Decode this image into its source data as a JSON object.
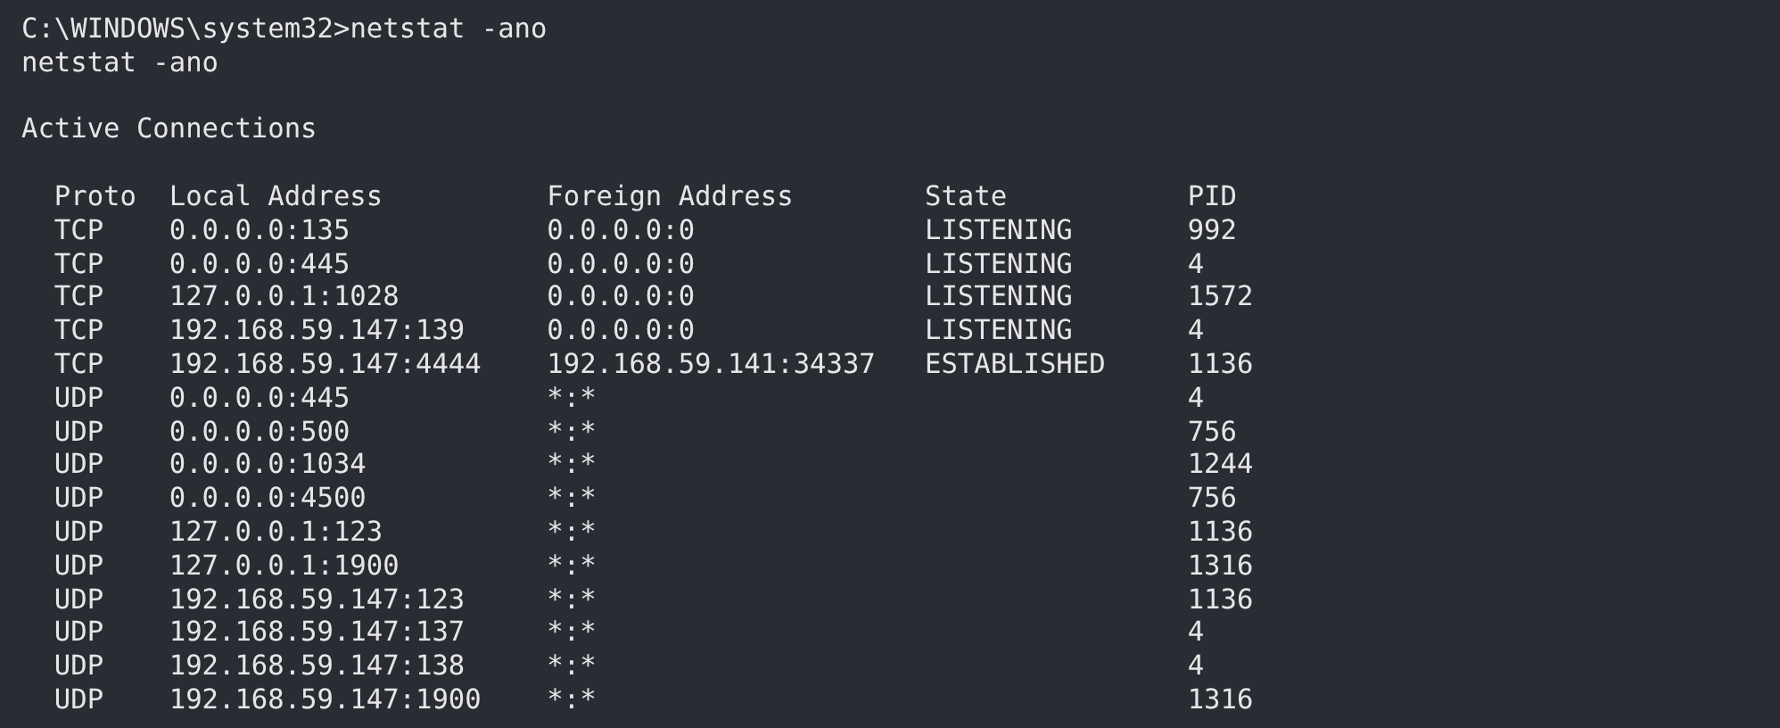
{
  "terminal": {
    "lines": [
      {
        "kind": "text",
        "text": "C:\\WINDOWS\\system32>netstat -ano"
      },
      {
        "kind": "text",
        "text": "netstat -ano"
      },
      {
        "kind": "blank"
      },
      {
        "kind": "text",
        "text": "Active Connections"
      },
      {
        "kind": "blank"
      }
    ],
    "table": {
      "columns": [
        "Proto",
        "Local Address",
        "Foreign Address",
        "State",
        "PID"
      ],
      "rows": [
        [
          "TCP",
          "0.0.0.0:135",
          "0.0.0.0:0",
          "LISTENING",
          "992"
        ],
        [
          "TCP",
          "0.0.0.0:445",
          "0.0.0.0:0",
          "LISTENING",
          "4"
        ],
        [
          "TCP",
          "127.0.0.1:1028",
          "0.0.0.0:0",
          "LISTENING",
          "1572"
        ],
        [
          "TCP",
          "192.168.59.147:139",
          "0.0.0.0:0",
          "LISTENING",
          "4"
        ],
        [
          "TCP",
          "192.168.59.147:4444",
          "192.168.59.141:34337",
          "ESTABLISHED",
          "1136"
        ],
        [
          "UDP",
          "0.0.0.0:445",
          "*:*",
          "",
          "4"
        ],
        [
          "UDP",
          "0.0.0.0:500",
          "*:*",
          "",
          "756"
        ],
        [
          "UDP",
          "0.0.0.0:1034",
          "*:*",
          "",
          "1244"
        ],
        [
          "UDP",
          "0.0.0.0:4500",
          "*:*",
          "",
          "756"
        ],
        [
          "UDP",
          "127.0.0.1:123",
          "*:*",
          "",
          "1136"
        ],
        [
          "UDP",
          "127.0.0.1:1900",
          "*:*",
          "",
          "1316"
        ],
        [
          "UDP",
          "192.168.59.147:123",
          "*:*",
          "",
          "1136"
        ],
        [
          "UDP",
          "192.168.59.147:137",
          "*:*",
          "",
          "4"
        ],
        [
          "UDP",
          "192.168.59.147:138",
          "*:*",
          "",
          "4"
        ],
        [
          "UDP",
          "192.168.59.147:1900",
          "*:*",
          "",
          "1316"
        ]
      ]
    }
  }
}
